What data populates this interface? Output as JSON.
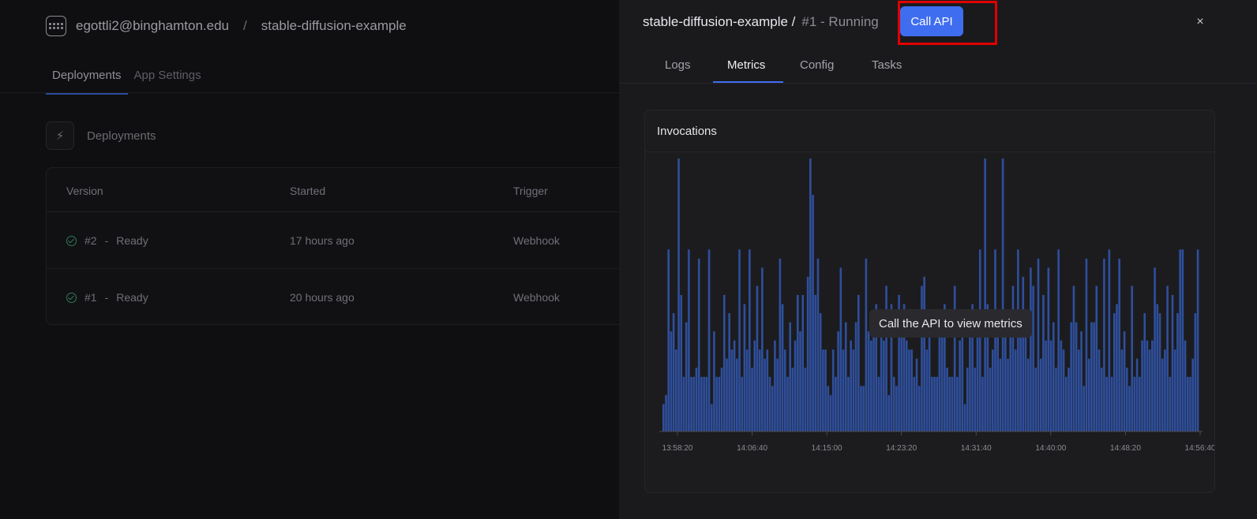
{
  "background": {
    "breadcrumb": {
      "account": "egottli2@binghamton.edu",
      "separator": "/",
      "app": "stable-diffusion-example"
    },
    "tabs": [
      {
        "label": "Deployments"
      },
      {
        "label": "App Settings"
      }
    ],
    "section": {
      "title": "Deployments"
    },
    "table": {
      "columns": [
        "Version",
        "Started",
        "Trigger"
      ],
      "rows": [
        {
          "version": "#2",
          "sep": "-",
          "status": "Ready",
          "started": "17 hours ago",
          "trigger": "Webhook"
        },
        {
          "version": "#1",
          "sep": "-",
          "status": "Ready",
          "started": "20 hours ago",
          "trigger": "Webhook"
        }
      ]
    }
  },
  "panel": {
    "title": "stable-diffusion-example /",
    "status": "#1 - Running",
    "call_api_label": "Call API",
    "close_label": "×",
    "tabs": [
      {
        "label": "Logs"
      },
      {
        "label": "Metrics"
      },
      {
        "label": "Config"
      },
      {
        "label": "Tasks"
      }
    ],
    "card_title": "Invocations",
    "tooltip": "Call the API to view metrics"
  },
  "colors": {
    "accent": "#3f6df0",
    "bar": "#2f4f9c",
    "highlight_box": "#e00000",
    "success": "#2f7a54"
  },
  "icons": {
    "app": "grid-icon",
    "section": "bolt-icon",
    "status": "check-circle-icon",
    "close": "close-icon"
  },
  "chart_data": {
    "type": "bar",
    "title": "Invocations",
    "x_tick_labels": [
      "13:58:20",
      "14:06:40",
      "14:15:00",
      "14:23:20",
      "14:31:40",
      "14:40:00",
      "14:48:20",
      "14:56:40"
    ],
    "ylim": [
      0,
      3
    ],
    "grid": false,
    "values": [
      0.3,
      0.4,
      2,
      1.1,
      1.3,
      0.9,
      3,
      1.5,
      0.6,
      1.2,
      2,
      0.6,
      0.6,
      0.7,
      1.9,
      0.6,
      0.6,
      0.6,
      2,
      0.3,
      1.1,
      0.6,
      0.6,
      0.7,
      1.5,
      0.8,
      1.3,
      0.9,
      1,
      0.8,
      2,
      0.6,
      1.4,
      0.9,
      2,
      0.7,
      1,
      1.6,
      0.9,
      1.8,
      0.8,
      0.9,
      0.6,
      0.5,
      1,
      0.8,
      1.9,
      1.4,
      0.9,
      0.6,
      1.2,
      0.7,
      1,
      1.5,
      1.1,
      1.5,
      0.7,
      1.7,
      3,
      2.6,
      1.5,
      1.9,
      1.3,
      0.9,
      0.9,
      0.5,
      0.4,
      0.9,
      0.6,
      1.1,
      1.8,
      0.9,
      1.2,
      0.6,
      1,
      0.9,
      1.2,
      1.5,
      0.5,
      0.5,
      1.9,
      1.1,
      1,
      1.1,
      1.4,
      0.6,
      1.2,
      1,
      1.6,
      0.4,
      1.4,
      0.6,
      0.5,
      1.5,
      1.1,
      1.4,
      1,
      0.9,
      0.9,
      0.6,
      0.8,
      0.5,
      1.6,
      1.7,
      0.9,
      1.3,
      0.6,
      0.6,
      0.6,
      1.1,
      1.2,
      1.4,
      0.7,
      0.6,
      0.6,
      1.6,
      0.6,
      1,
      1.2,
      0.3,
      0.7,
      1.2,
      1.4,
      0.7,
      1.3,
      2,
      0.6,
      3,
      1.4,
      0.7,
      0.9,
      2,
      1.2,
      0.8,
      3,
      1.2,
      0.8,
      1.1,
      1.6,
      0.9,
      2,
      1.3,
      1.7,
      1.1,
      0.8,
      1.8,
      1.6,
      0.7,
      1.9,
      0.8,
      1.5,
      1,
      1.8,
      1,
      1.2,
      0.7,
      2,
      1,
      0.9,
      0.6,
      0.7,
      1.2,
      1.6,
      1.2,
      0.9,
      1.1,
      0.5,
      1.9,
      0.8,
      1.2,
      1.2,
      1.6,
      0.9,
      0.7,
      1.9,
      0.6,
      2,
      0.6,
      1.3,
      1.4,
      1.9,
      0.9,
      1.1,
      0.7,
      0.5,
      1.6,
      0.6,
      0.8,
      0.6,
      1,
      1.3,
      1,
      0.9,
      1,
      1.8,
      1.4,
      1.3,
      0.8,
      0.9,
      1.6,
      0.6,
      1.5,
      0.9,
      1.3,
      2,
      2,
      1,
      0.6,
      0.6,
      0.8,
      1.3,
      2
    ]
  }
}
